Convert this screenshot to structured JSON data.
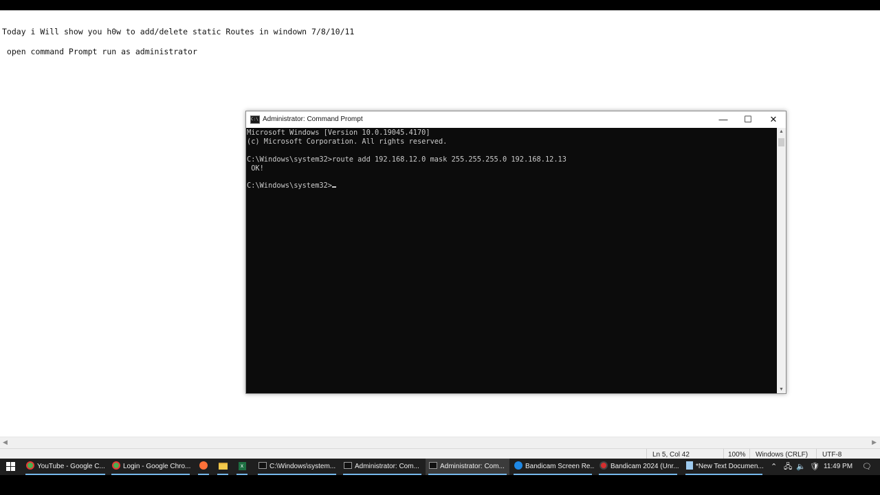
{
  "notepad": {
    "lines": [
      "Today i Will show you h0w to add/delete static Routes in windown 7/8/10/11",
      " open command Prompt run as administrator"
    ],
    "status": {
      "position": "Ln 5, Col 42",
      "zoom": "100%",
      "line_ending": "Windows (CRLF)",
      "encoding": "UTF-8"
    }
  },
  "cmd_window": {
    "title": "Administrator: Command Prompt",
    "icon": "cmd-icon",
    "minimize_glyph": "—",
    "maximize_glyph": "☐",
    "close_glyph": "✕",
    "console_lines": [
      "Microsoft Windows [Version 10.0.19045.4170]",
      "(c) Microsoft Corporation. All rights reserved.",
      "",
      "C:\\Windows\\system32>route add 192.168.12.0 mask 255.255.255.0 192.168.12.13",
      " OK!",
      "",
      "C:\\Windows\\system32>"
    ]
  },
  "taskbar": {
    "start_icon": "windows-start-icon",
    "items": [
      {
        "label": "YouTube - Google C...",
        "icon": "chrome-icon",
        "color": "#4caf50"
      },
      {
        "label": "Login - Google Chro...",
        "icon": "chrome-icon",
        "color": "#4caf50"
      },
      {
        "label": "",
        "icon": "firefox-icon",
        "color": "#ff7139"
      },
      {
        "label": "",
        "icon": "folder-icon",
        "color": "#f2c94c"
      },
      {
        "label": "",
        "icon": "excel-icon",
        "color": "#1d6f42"
      },
      {
        "label": "C:\\Windows\\system...",
        "icon": "cmd-icon",
        "color": "#111111"
      },
      {
        "label": "Administrator: Com...",
        "icon": "cmd-icon",
        "color": "#111111"
      },
      {
        "label": "Administrator: Com...",
        "icon": "cmd-icon",
        "color": "#111111"
      },
      {
        "label": "Bandicam Screen Re...",
        "icon": "edge-icon",
        "color": "#1e88e5"
      },
      {
        "label": "Bandicam 2024 (Unr...",
        "icon": "bandicam-icon",
        "color": "#d32f2f"
      },
      {
        "label": "*New Text Documen...",
        "icon": "notepad-icon",
        "color": "#9ecbf0"
      }
    ],
    "tray": {
      "time": "11:49 PM"
    }
  }
}
